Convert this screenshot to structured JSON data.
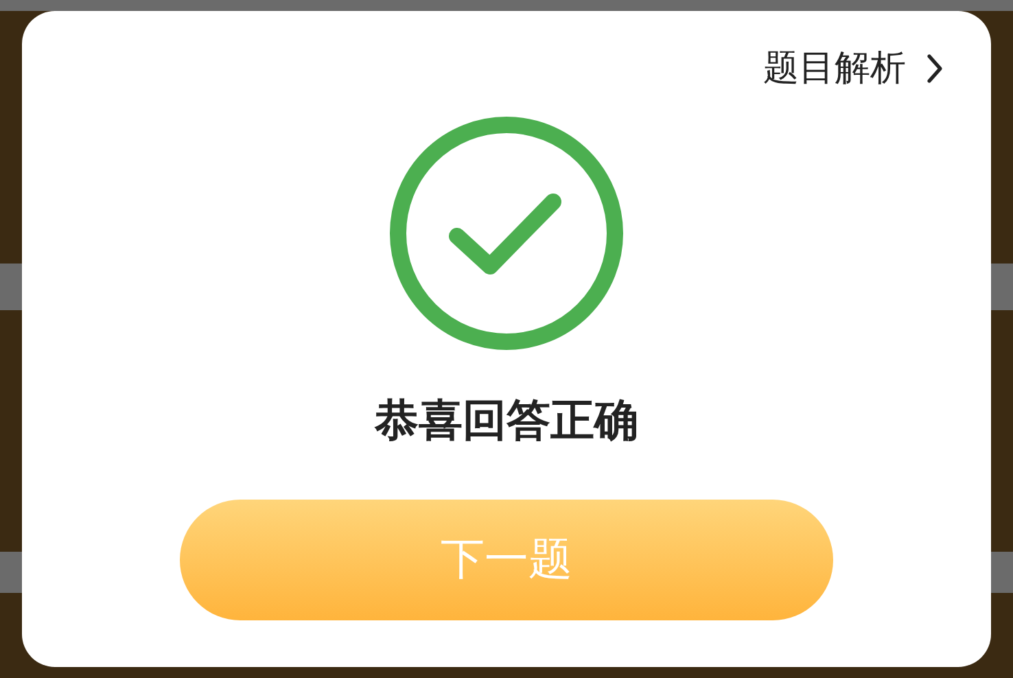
{
  "analysis_link": {
    "label": "题目解析"
  },
  "result": {
    "kind": "correct",
    "message": "恭喜回答正确"
  },
  "next_button": {
    "label": "下一题"
  }
}
